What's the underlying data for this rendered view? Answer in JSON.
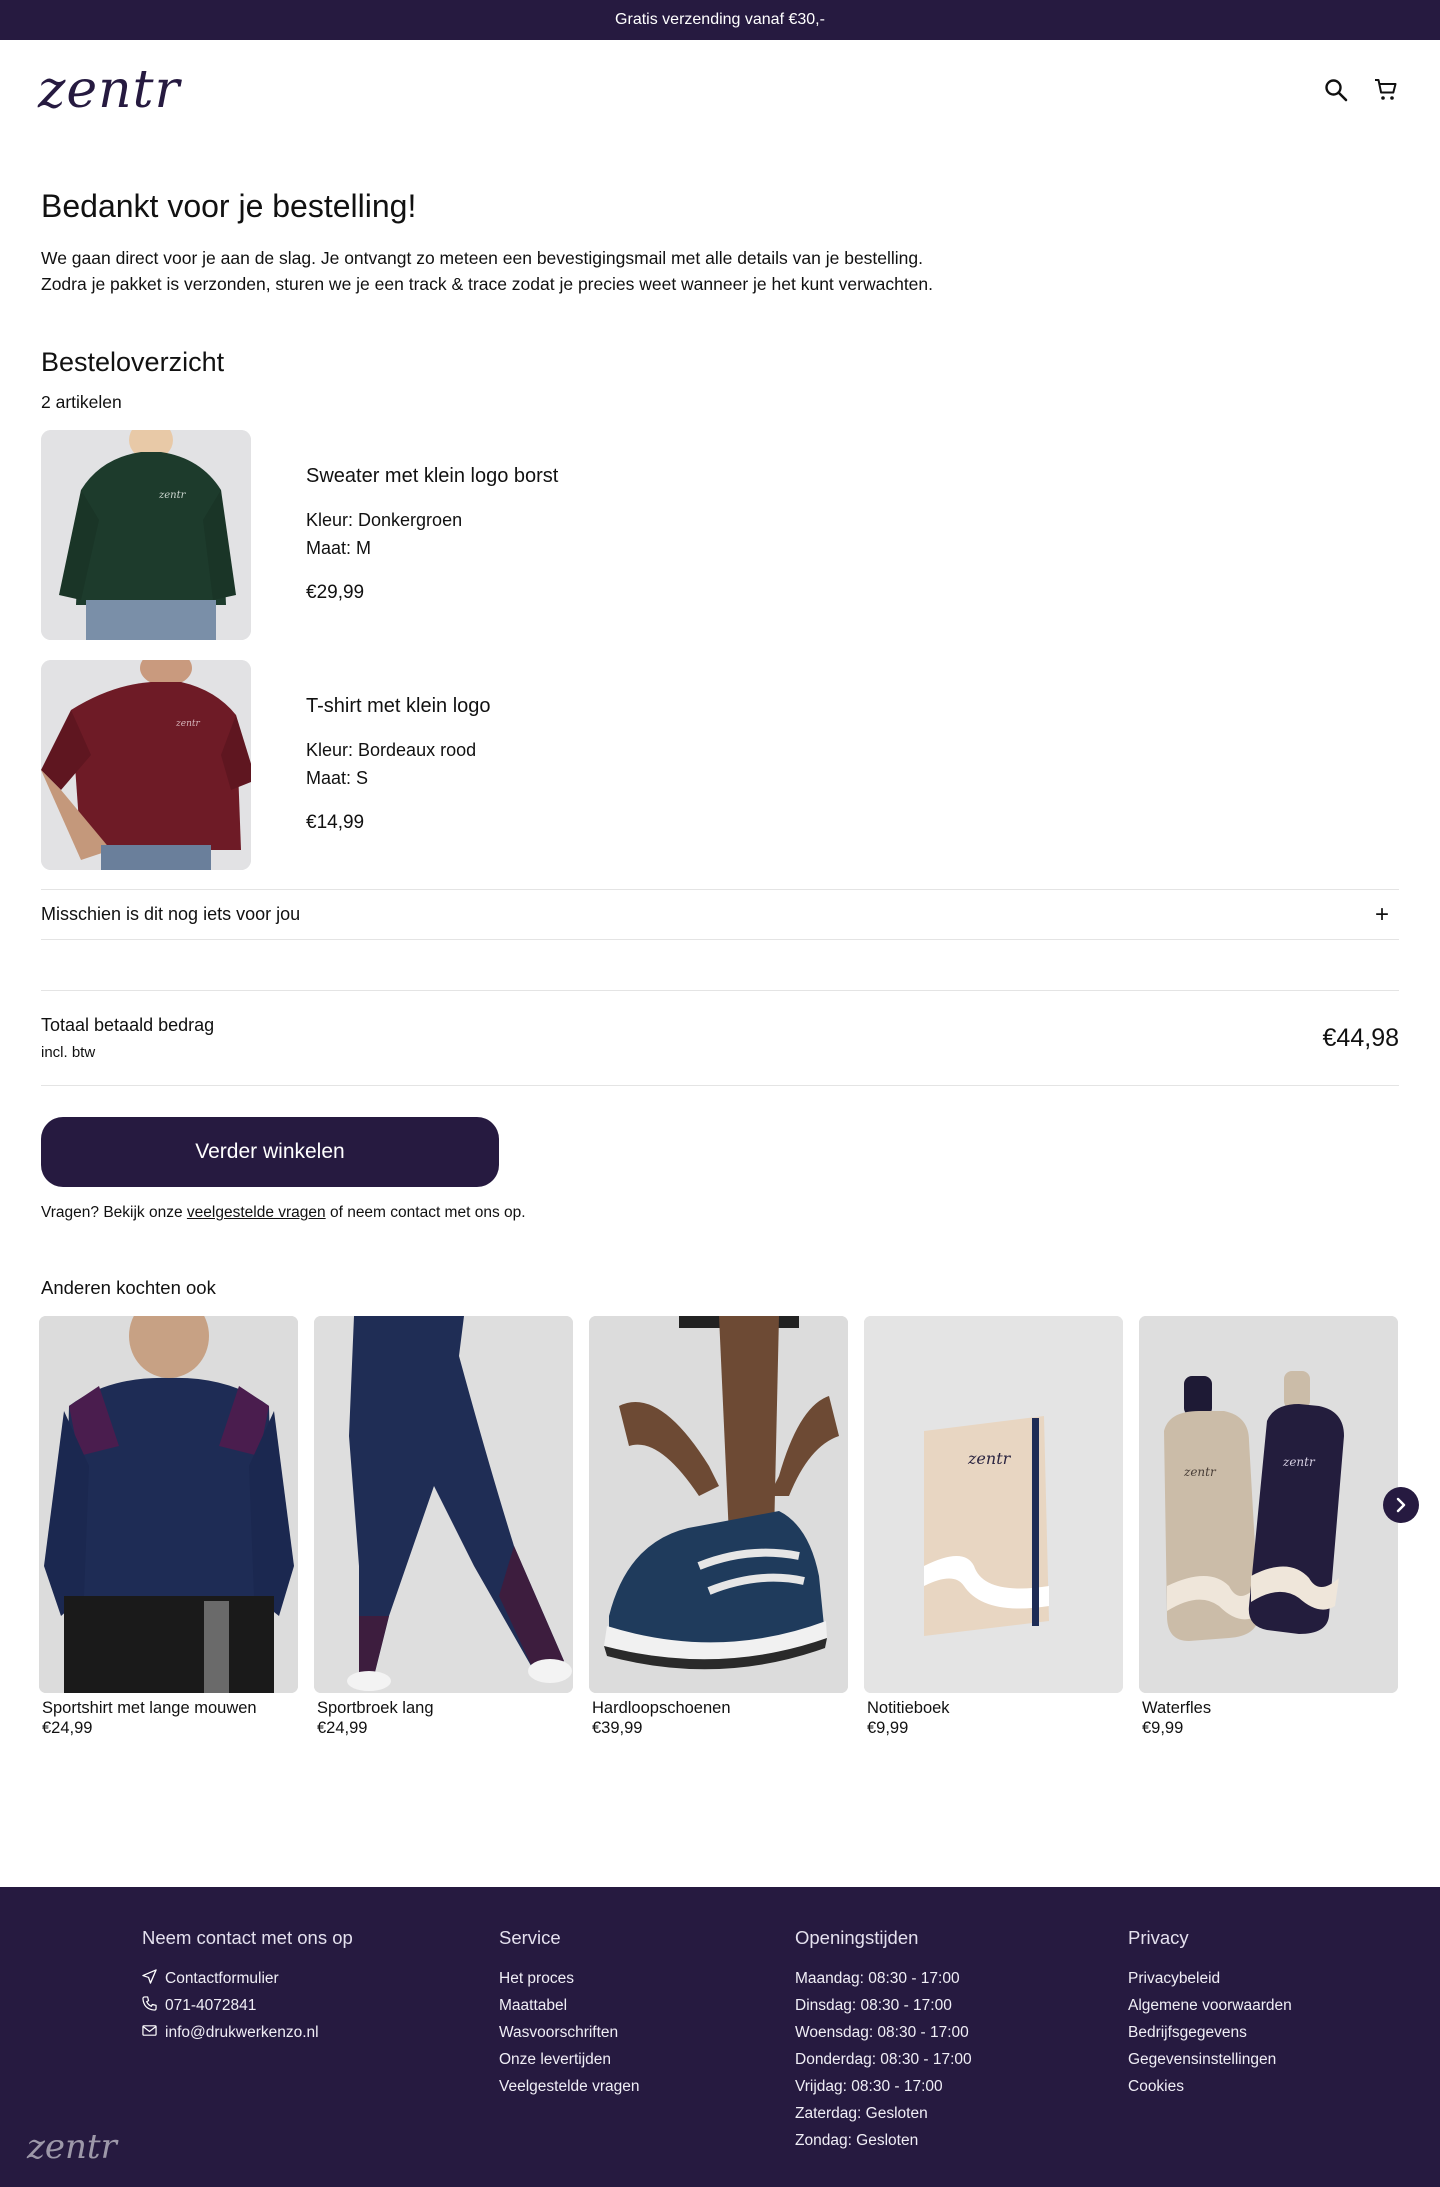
{
  "topbar": {
    "text": "Gratis verzending vanaf €30,-"
  },
  "header": {
    "logo": "zentr",
    "icons": [
      "search-icon",
      "cart-icon"
    ]
  },
  "confirmation": {
    "title": "Bedankt voor je bestelling!",
    "line1": "We gaan direct voor je aan de slag. Je ontvangt zo meteen een bevestigingsmail met alle details van je bestelling.",
    "line2": "Zodra je pakket is verzonden, sturen we je een track & trace zodat je precies weet wanneer je het kunt verwachten."
  },
  "order": {
    "title": "Besteloverzicht",
    "count": "2 artikelen",
    "items": [
      {
        "name": "Sweater met klein logo borst",
        "color": "Kleur: Donkergroen",
        "size": "Maat: M",
        "price": "€29,99"
      },
      {
        "name": "T-shirt met klein logo",
        "color": "Kleur: Bordeaux rood",
        "size": "Maat: S",
        "price": "€14,99"
      }
    ]
  },
  "accordion": {
    "label": "Misschien is dit nog iets voor jou",
    "icon": "+"
  },
  "total": {
    "label": "Totaal betaald bedrag",
    "sub": "incl. btw",
    "amount": "€44,98"
  },
  "cta": {
    "label": "Verder winkelen"
  },
  "questions": {
    "prefix": "Vragen? Bekijk onze ",
    "link": "veelgestelde vragen",
    "suffix": " of neem contact met ons op."
  },
  "others": {
    "title": "Anderen kochten ook",
    "products": [
      {
        "name": "Sportshirt met lange mouwen",
        "price": "€24,99"
      },
      {
        "name": "Sportbroek lang",
        "price": "€24,99"
      },
      {
        "name": "Hardloopschoenen",
        "price": "€39,99"
      },
      {
        "name": "Notitieboek",
        "price": "€9,99"
      },
      {
        "name": "Waterfles",
        "price": "€9,99"
      }
    ],
    "product_label_logo": "zentr"
  },
  "footer": {
    "contact": {
      "title": "Neem contact met ons op",
      "items": [
        {
          "icon": "send-icon",
          "label": "Contactformulier"
        },
        {
          "icon": "phone-icon",
          "label": "071-4072841"
        },
        {
          "icon": "mail-icon",
          "label": "info@drukwerkenzo.nl"
        }
      ]
    },
    "service": {
      "title": "Service",
      "items": [
        "Het proces",
        "Maattabel",
        "Wasvoorschriften",
        "Onze levertijden",
        "Veelgestelde vragen"
      ]
    },
    "hours": {
      "title": "Openingstijden",
      "items": [
        "Maandag: 08:30 - 17:00",
        "Dinsdag: 08:30 - 17:00",
        "Woensdag: 08:30 - 17:00",
        "Donderdag: 08:30 - 17:00",
        "Vrijdag: 08:30 - 17:00",
        "Zaterdag: Gesloten",
        "Zondag: Gesloten"
      ]
    },
    "privacy": {
      "title": "Privacy",
      "items": [
        "Privacybeleid",
        "Algemene voorwaarden",
        "Bedrijfsgegevens",
        "Gegevensinstellingen",
        "Cookies"
      ]
    },
    "logo": "zentr"
  },
  "colors": {
    "brand": "#261a40",
    "sweater": "#1d3b2c",
    "tshirt": "#6e1b26",
    "navy": "#1e2c55"
  }
}
